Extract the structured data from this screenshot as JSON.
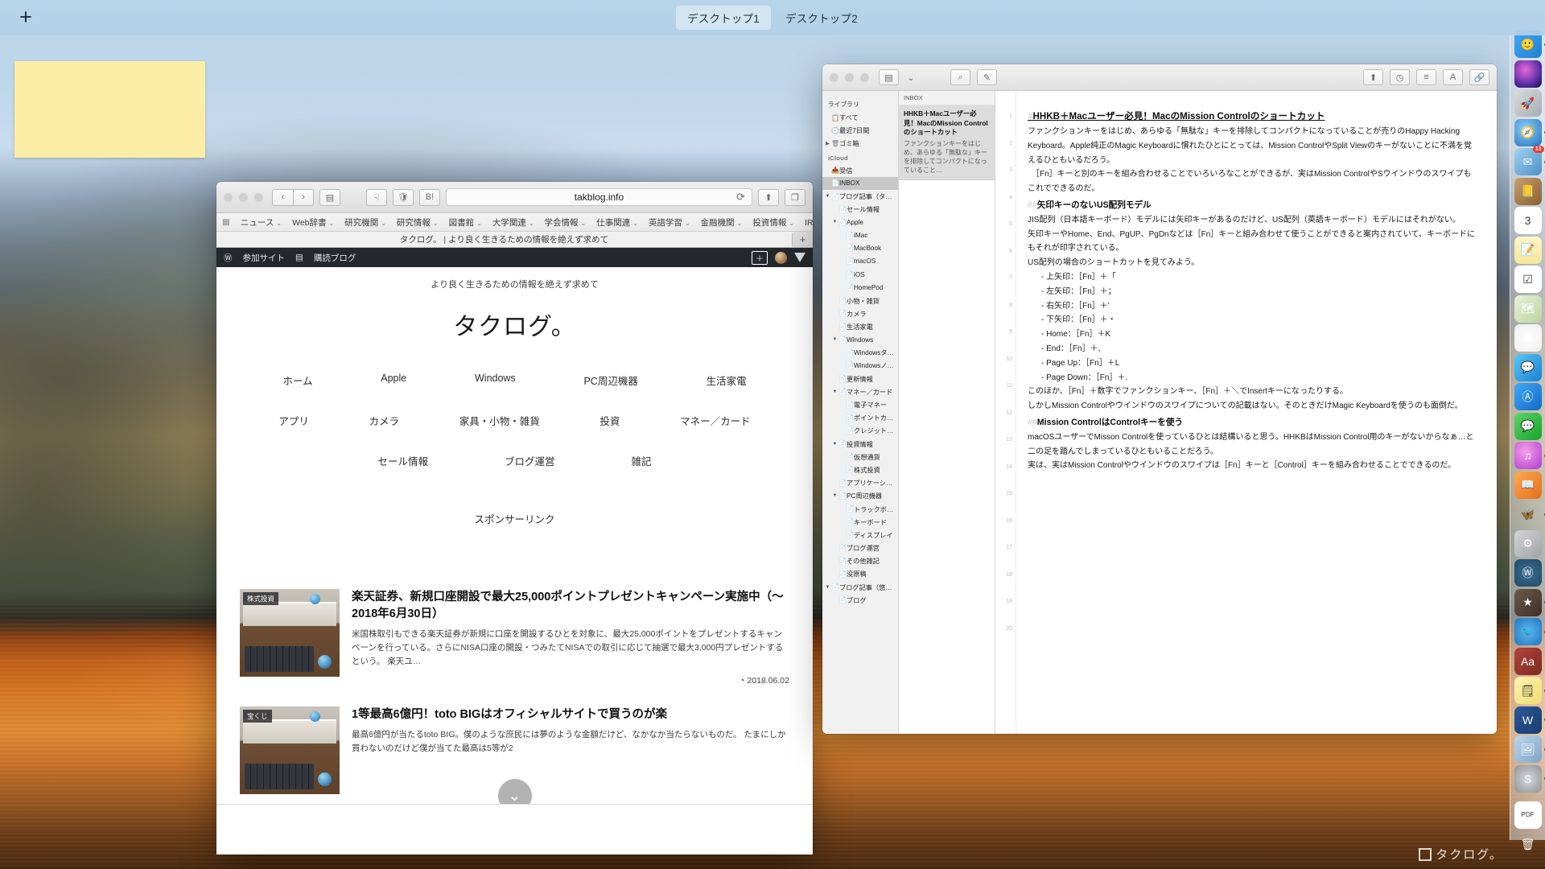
{
  "spaces": {
    "add_label": "+",
    "tabs": [
      {
        "label": "デスクトップ1",
        "active": true
      },
      {
        "label": "デスクトップ2",
        "active": false
      }
    ]
  },
  "safari": {
    "url": "takblog.info",
    "reload_icon": "⟳",
    "back_icon": "‹",
    "forward_icon": "›",
    "sidebar_icon": "▤",
    "share_icon": "⬆",
    "tabs_icon": "❐",
    "ext_hand_icon": "☟",
    "ext_shield_icon": "🛡",
    "ext_hatena_label": "B!",
    "bookmarks_grid_icon": "▦",
    "bookmarks": [
      "ニュース",
      "Web辞書",
      "研究機関",
      "研究情報",
      "図書館",
      "大学関連",
      "学会情報",
      "仕事関連",
      "英語学習",
      "金融機関",
      "投資情報",
      "IR情報"
    ],
    "bookmarks_overflow": "≫",
    "tab_title": "タクログ。 | より良く生きるための情報を絶えず求めて",
    "tab_plus": "+"
  },
  "wpbar": {
    "wp_icon": "Ⓦ",
    "my_sites": "参加サイト",
    "reader_icon": "▤",
    "reader": "購読ブログ",
    "new_post_icon": "＋",
    "notify_icon": "◆"
  },
  "site": {
    "tagline": "より良く生きるための情報を絶えず求めて",
    "title": "タクログ。",
    "nav_row1": [
      "ホーム",
      "Apple",
      "Windows",
      "PC周辺機器",
      "生活家電"
    ],
    "nav_row2": [
      "アプリ",
      "カメラ",
      "家具・小物・雑貨",
      "投資",
      "マネー／カード"
    ],
    "nav_row3": [
      "セール情報",
      "ブログ運営",
      "雑記"
    ],
    "sponsor": "スポンサーリンク",
    "posts": [
      {
        "category": "株式投資",
        "title": "楽天証券、新規口座開設で最大25,000ポイントプレゼントキャンペーン実施中（〜2018年6月30日）",
        "excerpt": "米国株取引もできる楽天証券が新規に口座を開設するひとを対象に、最大25,000ポイントをプレゼントするキャンペーンを行っている。さらにNISA口座の開設・つみたてNISAでの取引に応じて抽選で最大3,000円プレゼントするという。 楽天ユ…",
        "date_icon": "◔",
        "date": "2018.06.02"
      },
      {
        "category": "宝くじ",
        "title": "1等最高6億円！toto BIGはオフィシャルサイトで買うのが楽",
        "excerpt": "最高6億円が当たるtoto BIG。僕のような庶民には夢のような金額だけど、なかなか当たらないものだ。 たまにしか買わないのだけど僕が当てた最高は5等が2",
        "date_icon": "◔",
        "date": ""
      }
    ],
    "scroll_arrow_icon": "⌄"
  },
  "notes": {
    "toolbar": {
      "sidebar_icon": "▤",
      "sidebar_chevron": "⌄",
      "search_icon": "⌕",
      "compose_icon": "✎",
      "share_icon": "⬆",
      "info_icon": "◷",
      "list_icon": "≡",
      "font_icon": "A",
      "attach_icon": "🔗"
    },
    "sidebar": {
      "sections": [
        {
          "header": "ライブラリ",
          "items": [
            {
              "label": "すべて",
              "icon": "📋",
              "indent": 1,
              "twisty": "",
              "selected": false
            },
            {
              "label": "最近7日間",
              "icon": "🕘",
              "indent": 1,
              "twisty": "",
              "selected": false
            },
            {
              "label": "ゴミ箱",
              "icon": "🗑",
              "indent": 1,
              "twisty": "▶",
              "selected": false
            }
          ]
        },
        {
          "header": "iCloud",
          "items": [
            {
              "label": "受信",
              "icon": "📥",
              "indent": 1,
              "twisty": "",
              "selected": false
            },
            {
              "label": "INBOX",
              "icon": "📄",
              "indent": 1,
              "twisty": "",
              "selected": true
            },
            {
              "label": "ブログ記事（タクログ）",
              "icon": "📄",
              "indent": 1,
              "twisty": "▼",
              "selected": false
            },
            {
              "label": "セール情報",
              "icon": "📄",
              "indent": 2,
              "twisty": "",
              "selected": false
            },
            {
              "label": "Apple",
              "icon": "📄",
              "indent": 2,
              "twisty": "▼",
              "selected": false
            },
            {
              "label": "iMac",
              "icon": "📄",
              "indent": 3,
              "twisty": "",
              "selected": false
            },
            {
              "label": "MacBook",
              "icon": "📄",
              "indent": 3,
              "twisty": "",
              "selected": false
            },
            {
              "label": "macOS",
              "icon": "📄",
              "indent": 3,
              "twisty": "",
              "selected": false
            },
            {
              "label": "iOS",
              "icon": "📄",
              "indent": 3,
              "twisty": "",
              "selected": false
            },
            {
              "label": "HomePod",
              "icon": "📄",
              "indent": 3,
              "twisty": "",
              "selected": false
            },
            {
              "label": "小物・雑貨",
              "icon": "📄",
              "indent": 2,
              "twisty": "",
              "selected": false
            },
            {
              "label": "カメラ",
              "icon": "📄",
              "indent": 2,
              "twisty": "",
              "selected": false
            },
            {
              "label": "生活家電",
              "icon": "📄",
              "indent": 2,
              "twisty": "",
              "selected": false
            },
            {
              "label": "Windows",
              "icon": "📄",
              "indent": 2,
              "twisty": "▼",
              "selected": false
            },
            {
              "label": "Windowsタブレ…",
              "icon": "📄",
              "indent": 3,
              "twisty": "",
              "selected": false
            },
            {
              "label": "WindowsノートPC",
              "icon": "📄",
              "indent": 3,
              "twisty": "",
              "selected": false
            },
            {
              "label": "更新情報",
              "icon": "📄",
              "indent": 2,
              "twisty": "",
              "selected": false
            },
            {
              "label": "マネー／カード",
              "icon": "📄",
              "indent": 2,
              "twisty": "▼",
              "selected": false
            },
            {
              "label": "電子マネー",
              "icon": "📄",
              "indent": 3,
              "twisty": "",
              "selected": false
            },
            {
              "label": "ポイントカード",
              "icon": "📄",
              "indent": 3,
              "twisty": "",
              "selected": false
            },
            {
              "label": "クレジットカード",
              "icon": "📄",
              "indent": 3,
              "twisty": "",
              "selected": false
            },
            {
              "label": "投資情報",
              "icon": "📄",
              "indent": 2,
              "twisty": "▼",
              "selected": false
            },
            {
              "label": "仮想通貨",
              "icon": "📄",
              "indent": 3,
              "twisty": "",
              "selected": false
            },
            {
              "label": "株式投資",
              "icon": "📄",
              "indent": 3,
              "twisty": "",
              "selected": false
            },
            {
              "label": "アプリケーション",
              "icon": "📄",
              "indent": 2,
              "twisty": "",
              "selected": false
            },
            {
              "label": "PC周辺機器",
              "icon": "📄",
              "indent": 2,
              "twisty": "▼",
              "selected": false
            },
            {
              "label": "トラックボール",
              "icon": "📄",
              "indent": 3,
              "twisty": "",
              "selected": false
            },
            {
              "label": "キーボード",
              "icon": "📄",
              "indent": 3,
              "twisty": "",
              "selected": false
            },
            {
              "label": "ディスプレイ",
              "icon": "📄",
              "indent": 3,
              "twisty": "",
              "selected": false
            },
            {
              "label": "ブログ運営",
              "icon": "📄",
              "indent": 2,
              "twisty": "",
              "selected": false
            },
            {
              "label": "その他雑記",
              "icon": "📄",
              "indent": 2,
              "twisty": "",
              "selected": false
            },
            {
              "label": "没原稿",
              "icon": "📄",
              "indent": 2,
              "twisty": "",
              "selected": false
            },
            {
              "label": "ブログ記事（悠木貴仁）",
              "icon": "📄",
              "indent": 1,
              "twisty": "▼",
              "selected": false
            },
            {
              "label": "ブログ",
              "icon": "📄",
              "indent": 2,
              "twisty": "",
              "selected": false
            }
          ]
        }
      ]
    },
    "list": {
      "header": "INBOX",
      "items": [
        {
          "title": "HHKB＋Macユーザー必見！MacのMission Controlのショートカット",
          "preview": "ファンクションキーをはじめ、あらゆる「無駄な」キーを排除してコンパクトになっていること…"
        }
      ]
    },
    "document": {
      "blocks": [
        {
          "type": "h1",
          "hash": "#",
          "text": "HHKB＋Macユーザー必見！MacのMission Controlのショートカット"
        },
        {
          "type": "p",
          "text": "ファンクションキーをはじめ、あらゆる「無駄な」キーを排除してコンパクトになっていることが売りのHappy Hacking Keyboard。Apple純正のMagic Keyboardに慣れたひとにとっては、Mission ControlやSplit Viewのキーがないことに不満を覚えるひともいるだろう。"
        },
        {
          "type": "p",
          "text": "　［Fn］キーと別のキーを組み合わせることでいろいろなことができるが、実はMission ControlやSウインドウのスワイプもこれでできるのだ。"
        },
        {
          "type": "h2",
          "hash": "##",
          "text": "矢印キーのないUS配列モデル"
        },
        {
          "type": "p",
          "text": "JIS配列（日本語キーボード）モデルには矢印キーがあるのだけど、US配列（英語キーボード）モデルにはそれがない。"
        },
        {
          "type": "p",
          "text": "矢印キーやHome、End、PgUP、PgDnなどは［Fn］キーと組み合わせて使うことができると案内されていて、キーボードにもそれが印字されている。"
        },
        {
          "type": "p",
          "text": "US配列の場合のショートカットを見てみよう。"
        },
        {
          "type": "li",
          "text": "- 上矢印：［Fn］＋「"
        },
        {
          "type": "li",
          "text": "- 左矢印：［Fn］＋；"
        },
        {
          "type": "li",
          "text": "- 右矢印：［Fn］＋'"
        },
        {
          "type": "li",
          "text": "- 下矢印：［Fn］＋・"
        },
        {
          "type": "li",
          "text": "- Home：［Fn］＋K"
        },
        {
          "type": "li",
          "text": "- End：［Fn］＋,"
        },
        {
          "type": "li",
          "text": "- Page Up：［Fn］＋L"
        },
        {
          "type": "li",
          "text": "- Page Down：［Fn］＋."
        },
        {
          "type": "p",
          "text": "このほか、［Fn］＋数字でファンクションキー、［Fn］＋＼でInsertキーになったりする。"
        },
        {
          "type": "p",
          "text": "しかしMission Controlやウインドウのスワイプについての記載はない。そのときだけMagic Keyboardを使うのも面倒だ。"
        },
        {
          "type": "h2",
          "hash": "##",
          "text": "Mission ControlはControlキーを使う"
        },
        {
          "type": "p",
          "text": "macOSユーザーでMisson Controlを使っているひとは結構いると思う。HHKBはMission Control用のキーがないからなぁ…と二の足を踏んでしまっているひともいることだろう。"
        },
        {
          "type": "p",
          "text": "実は、実はMission Controlやウインドウのスワイプは［Fn］キーと［Control］キーを組み合わせることでできるのだ。"
        }
      ],
      "line_numbers": [
        "1",
        "2",
        "3",
        "4",
        "5",
        "6",
        "7",
        "8",
        "9",
        "10",
        "11",
        "12",
        "13",
        "14",
        "15",
        "16",
        "17",
        "18",
        "19",
        "20"
      ]
    }
  },
  "dock": {
    "items": [
      {
        "name": "finder",
        "glyph": "🙂",
        "bg": "linear-gradient(135deg,#3fa9f5,#1f7fd4)",
        "running": true,
        "badge": ""
      },
      {
        "name": "siri",
        "glyph": "",
        "bg": "radial-gradient(circle at 40% 35%,#e868d6,#5a2ea8 60%,#1b1038)",
        "running": false,
        "badge": ""
      },
      {
        "name": "launchpad",
        "glyph": "🚀",
        "bg": "linear-gradient(135deg,#d9dbdd,#a9adb2)",
        "running": false,
        "badge": ""
      },
      {
        "name": "safari",
        "glyph": "🧭",
        "bg": "radial-gradient(circle at 40% 35%,#8fd0f5,#2170c4)",
        "running": true,
        "badge": ""
      },
      {
        "name": "mail",
        "glyph": "✉",
        "bg": "linear-gradient(135deg,#9fd3ef,#4d8fc9)",
        "running": true,
        "badge": "13"
      },
      {
        "name": "contacts",
        "glyph": "📒",
        "bg": "linear-gradient(135deg,#c9a06b,#8a5f32)",
        "running": false,
        "badge": ""
      },
      {
        "name": "calendar",
        "glyph": "3",
        "bg": "#ffffff",
        "running": false,
        "badge": ""
      },
      {
        "name": "notes",
        "glyph": "📝",
        "bg": "linear-gradient(to bottom,#fdf6c8,#f5e79a)",
        "running": false,
        "badge": ""
      },
      {
        "name": "reminders",
        "glyph": "☑",
        "bg": "#ffffff",
        "running": false,
        "badge": ""
      },
      {
        "name": "maps",
        "glyph": "🗺",
        "bg": "linear-gradient(135deg,#e9f0d8,#bcd4a0)",
        "running": false,
        "badge": ""
      },
      {
        "name": "photos",
        "glyph": "❀",
        "bg": "radial-gradient(circle,#ffffff,#eeeeee)",
        "running": false,
        "badge": ""
      },
      {
        "name": "messages",
        "glyph": "💬",
        "bg": "linear-gradient(135deg,#5ac8f5,#1a7fd4)",
        "running": false,
        "badge": ""
      },
      {
        "name": "app-store",
        "glyph": "Ⓐ",
        "bg": "linear-gradient(135deg,#3fa9f5,#1469c7)",
        "running": false,
        "badge": ""
      },
      {
        "name": "line",
        "glyph": "💬",
        "bg": "linear-gradient(135deg,#5fd36a,#18a32a)",
        "running": false,
        "badge": ""
      },
      {
        "name": "itunes",
        "glyph": "♫",
        "bg": "radial-gradient(circle at 40% 35%,#f4a0e8,#b03ad0)",
        "running": true,
        "badge": ""
      },
      {
        "name": "ibooks",
        "glyph": "📖",
        "bg": "linear-gradient(135deg,#ffa94d,#e2701a)",
        "running": false,
        "badge": ""
      },
      {
        "name": "evernote",
        "glyph": "🦋",
        "bg": "transparent",
        "running": true,
        "badge": ""
      },
      {
        "name": "system-preferences",
        "glyph": "⚙",
        "bg": "linear-gradient(135deg,#d4d6d8,#9ea2a6)",
        "running": false,
        "badge": ""
      },
      {
        "name": "wordpress",
        "glyph": "Ⓦ",
        "bg": "radial-gradient(circle,#3c6f90,#1f4a66)",
        "running": false,
        "badge": ""
      },
      {
        "name": "dropbox-star",
        "glyph": "★",
        "bg": "linear-gradient(135deg,#6b5a4a,#3d3027)",
        "running": true,
        "badge": ""
      },
      {
        "name": "twitter",
        "glyph": "🐦",
        "bg": "radial-gradient(circle,#5fb7ea,#1d76c4)",
        "running": true,
        "badge": ""
      },
      {
        "name": "dictionary",
        "glyph": "Aa",
        "bg": "linear-gradient(135deg,#b0443c,#7d2a23)",
        "running": false,
        "badge": ""
      },
      {
        "name": "stickies",
        "glyph": "🗒",
        "bg": "linear-gradient(135deg,#fdf3b0,#f0dd72)",
        "running": true,
        "badge": ""
      },
      {
        "name": "word",
        "glyph": "W",
        "bg": "linear-gradient(135deg,#2b5797,#1b3d6e)",
        "running": true,
        "badge": ""
      },
      {
        "name": "preview",
        "glyph": "🖼",
        "bg": "linear-gradient(135deg,#bcd6ea,#7fa6c8)",
        "running": true,
        "badge": ""
      },
      {
        "name": "skitch",
        "glyph": "S",
        "bg": "radial-gradient(circle,#d6d8da,#8d9296)",
        "running": true,
        "badge": ""
      },
      {
        "name": "pdf-document",
        "glyph": "PDF",
        "bg": "#ffffff",
        "running": false,
        "badge": ""
      },
      {
        "name": "trash",
        "glyph": "🗑",
        "bg": "transparent",
        "running": false,
        "badge": ""
      }
    ]
  },
  "watermark": {
    "text": "タクログ。"
  }
}
